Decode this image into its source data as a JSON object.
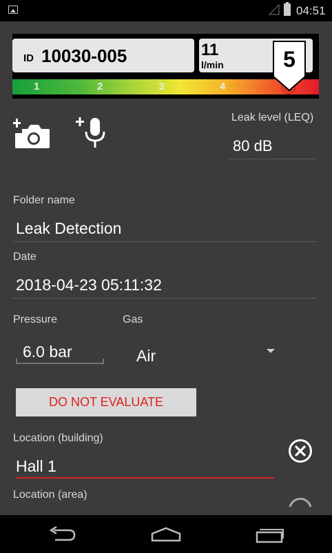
{
  "status_bar": {
    "time": "04:51"
  },
  "header": {
    "id_prefix": "ID",
    "id_value": "10030-005",
    "flow_value": "11",
    "flow_unit": "l/min",
    "grade": "5",
    "scale_labels": [
      "1",
      "2",
      "3",
      "4"
    ]
  },
  "leak_level": {
    "label": "Leak level (LEQ)",
    "value": "80 dB"
  },
  "form": {
    "folder_name_label": "Folder name",
    "folder_name_value": "Leak Detection",
    "date_label": "Date",
    "date_value": "2018-04-23 05:11:32",
    "pressure_label": "Pressure",
    "pressure_value": "6.0 bar",
    "gas_label": "Gas",
    "gas_value": "Air",
    "do_not_evaluate_label": "DO NOT EVALUATE",
    "location_building_label": "Location (building)",
    "location_building_value": "Hall 1",
    "location_area_label": "Location (area)"
  },
  "colors": {
    "accent_red": "#e02020",
    "background": "#3b3b3b"
  },
  "icons": [
    "add-photo-icon",
    "add-voice-icon",
    "clear-icon",
    "back-icon",
    "home-icon",
    "recent-apps-icon"
  ]
}
